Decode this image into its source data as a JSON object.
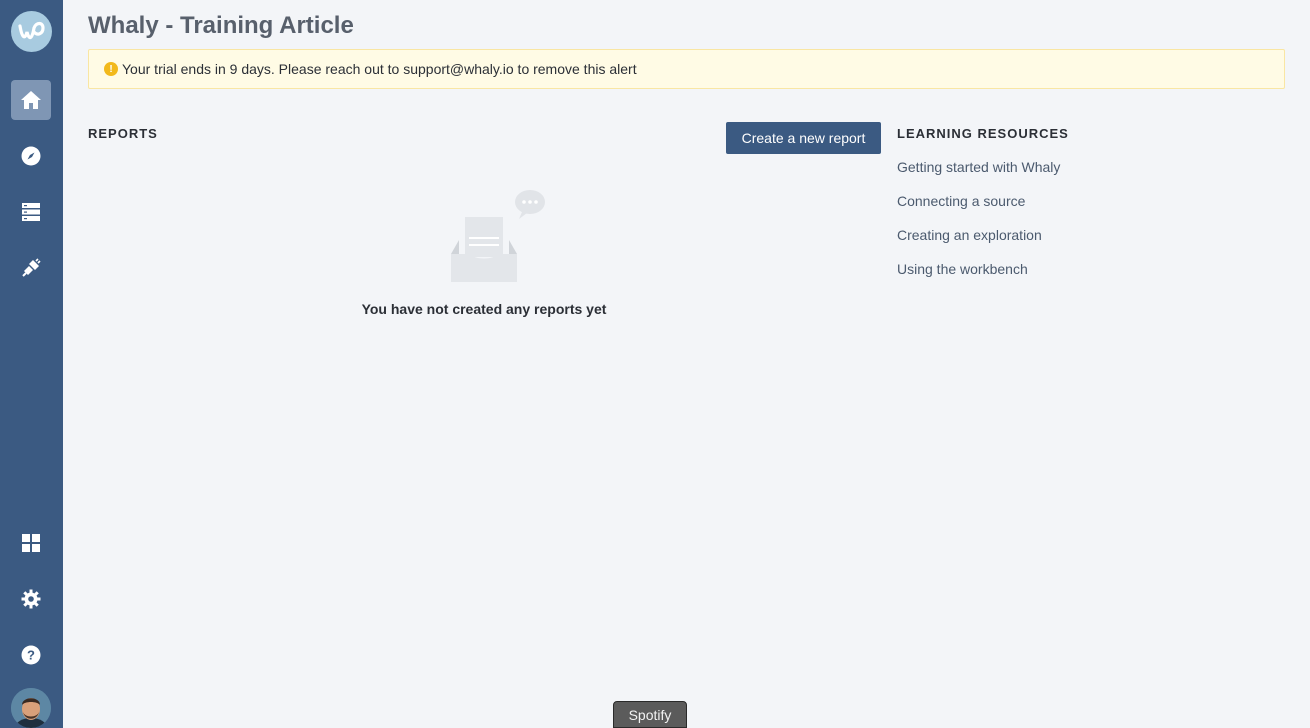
{
  "app": {
    "title": "Whaly - Training Article"
  },
  "sidebar": {
    "logo": "whaly-logo",
    "top_items": [
      {
        "name": "home",
        "icon": "home-icon",
        "active": true
      },
      {
        "name": "explore",
        "icon": "compass-icon",
        "active": false
      },
      {
        "name": "data",
        "icon": "database-icon",
        "active": false
      },
      {
        "name": "connections",
        "icon": "plug-icon",
        "active": false
      }
    ],
    "bottom_items": [
      {
        "name": "apps",
        "icon": "grid-icon"
      },
      {
        "name": "settings",
        "icon": "gear-icon"
      },
      {
        "name": "help",
        "icon": "question-icon"
      }
    ]
  },
  "alert": {
    "icon": "warning-icon",
    "text": "Your trial ends in 9 days. Please reach out to support@whaly.io to remove this alert"
  },
  "reports": {
    "heading": "REPORTS",
    "create_label": "Create a new report",
    "empty_text": "You have not created any reports yet"
  },
  "learning": {
    "heading": "LEARNING RESOURCES",
    "links": [
      "Getting started with Whaly",
      "Connecting a source",
      "Creating an exploration",
      "Using the workbench"
    ]
  },
  "dock": {
    "spotify_label": "Spotify"
  },
  "colors": {
    "sidebar": "#3b5a82",
    "primary_button": "#3b5a82",
    "alert_bg": "#fffbe5",
    "alert_icon": "#f2b91c"
  }
}
